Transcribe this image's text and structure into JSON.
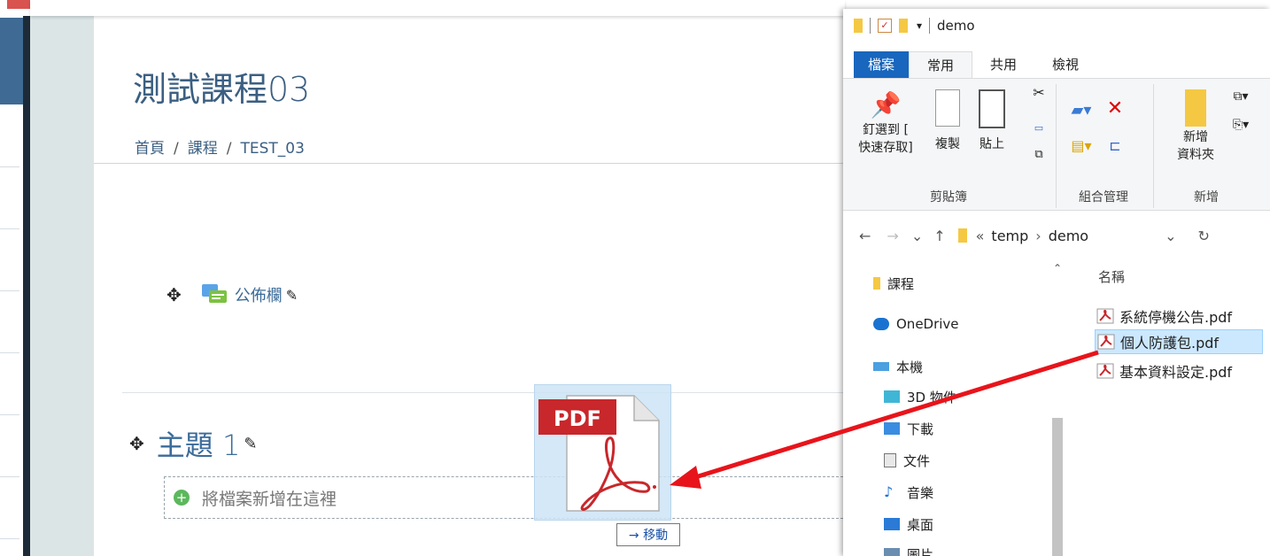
{
  "course": {
    "title": "測試課程03",
    "breadcrumb": [
      "首頁",
      "課程",
      "TEST_03"
    ],
    "forum_link": "公佈欄",
    "topic_title": "主題 1",
    "dropzone_text": "將檔案新增在這裡"
  },
  "drag": {
    "ghost_label": "PDF",
    "action_label": "→ 移動"
  },
  "explorer": {
    "window_title": "demo",
    "tabs": [
      "檔案",
      "常用",
      "共用",
      "檢視"
    ],
    "active_tab": "常用",
    "ribbon": {
      "pin_label_1": "釘選到 [",
      "pin_label_2": "快速存取]",
      "copy_label": "複製",
      "paste_label": "貼上",
      "new_folder_1": "新增",
      "new_folder_2": "資料夾",
      "group_clipboard": "剪貼簿",
      "group_organize": "組合管理",
      "group_new": "新增"
    },
    "address": {
      "back": "←",
      "forward": "→",
      "recent": "⌄",
      "up": "↑",
      "overflow": "«",
      "crumbs": [
        "temp",
        "demo"
      ],
      "dropdown": "⌄",
      "refresh": "↻"
    },
    "nav_items": [
      {
        "label": "課程",
        "icon": "folder-icon"
      },
      {
        "label": "OneDrive",
        "icon": "cloud-icon"
      },
      {
        "label": "本機",
        "icon": "computer-icon"
      },
      {
        "label": "3D 物件",
        "icon": "cube-icon"
      },
      {
        "label": "下載",
        "icon": "download-icon"
      },
      {
        "label": "文件",
        "icon": "document-icon"
      },
      {
        "label": "音樂",
        "icon": "music-icon"
      },
      {
        "label": "桌面",
        "icon": "desktop-icon"
      },
      {
        "label": "圖片",
        "icon": "picture-icon"
      }
    ],
    "column_header": "名稱",
    "files": [
      {
        "name": "系統停機公告.pdf",
        "selected": false
      },
      {
        "name": "個人防護包.pdf",
        "selected": true
      },
      {
        "name": "基本資料設定.pdf",
        "selected": false
      }
    ]
  },
  "colors": {
    "accent_link": "#3b6b9a",
    "drag_arrow": "#e8141b",
    "file_tab": "#1866bd",
    "selection": "#cce8ff"
  }
}
